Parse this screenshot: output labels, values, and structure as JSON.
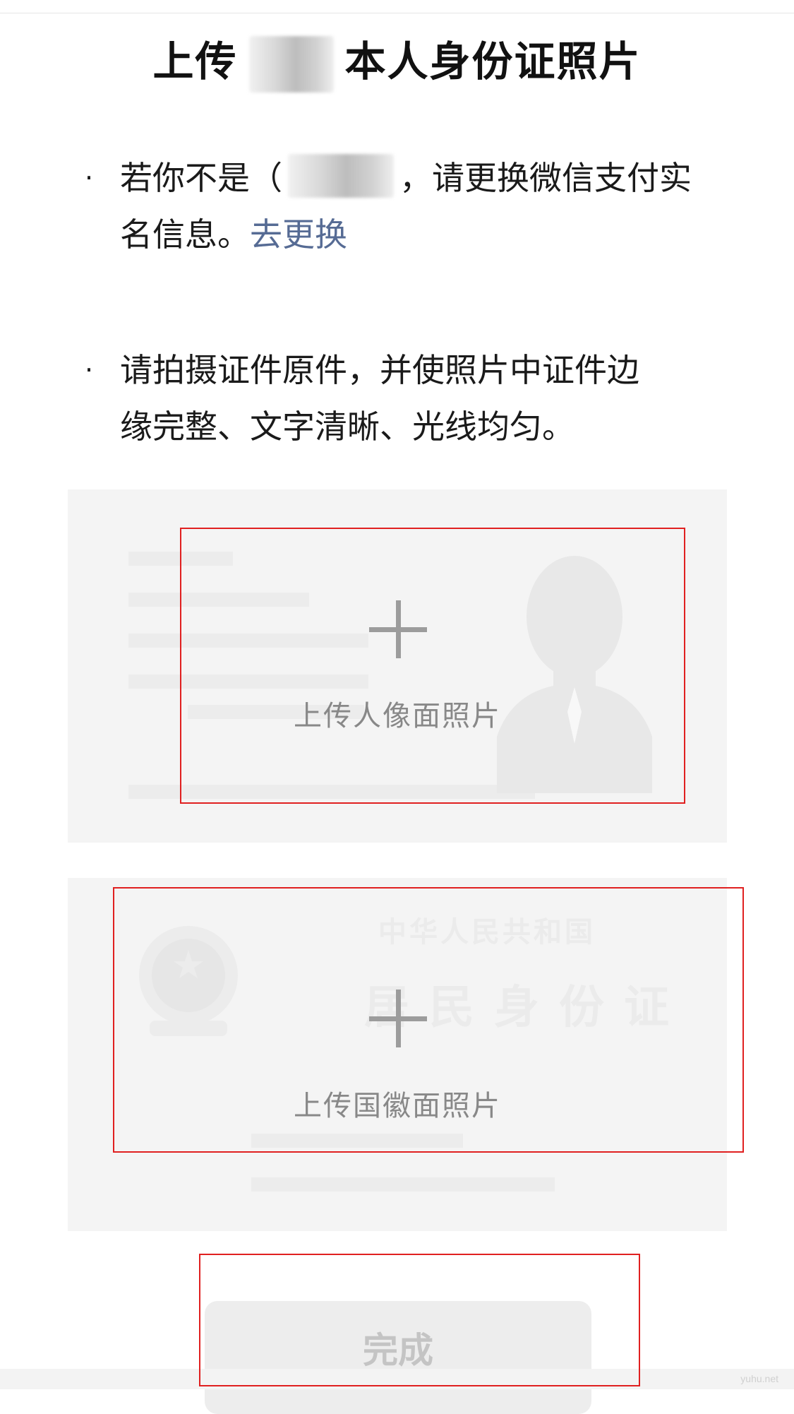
{
  "title": {
    "prefix": "上传",
    "suffix": "本人身份证照片"
  },
  "instructions": [
    {
      "bullet": "·",
      "line1_before": "若你不是（",
      "line1_after": "，请更换微信支付实",
      "line2": "名信息。",
      "link": "去更换"
    },
    {
      "bullet": "·",
      "line1": "请拍摄证件原件，并使照片中证件边",
      "line2": "缘完整、文字清晰、光线均匀。"
    }
  ],
  "upload_cards": {
    "front": {
      "label": "上传人像面照片",
      "icon": "plus-icon",
      "illustration": "portrait-silhouette-icon"
    },
    "back": {
      "label": "上传国徽面照片",
      "icon": "plus-icon",
      "illustration": "national-emblem-icon",
      "watermark_title": "中华人民共和国",
      "watermark_subtitle": "居民身份证"
    }
  },
  "done_button": {
    "label": "完成"
  },
  "site_watermark": "yuhu.net",
  "colors": {
    "link": "#566b94",
    "card_background": "#f4f4f4",
    "annotation": "#e02020",
    "button_disabled_text": "#c4c4c4"
  }
}
